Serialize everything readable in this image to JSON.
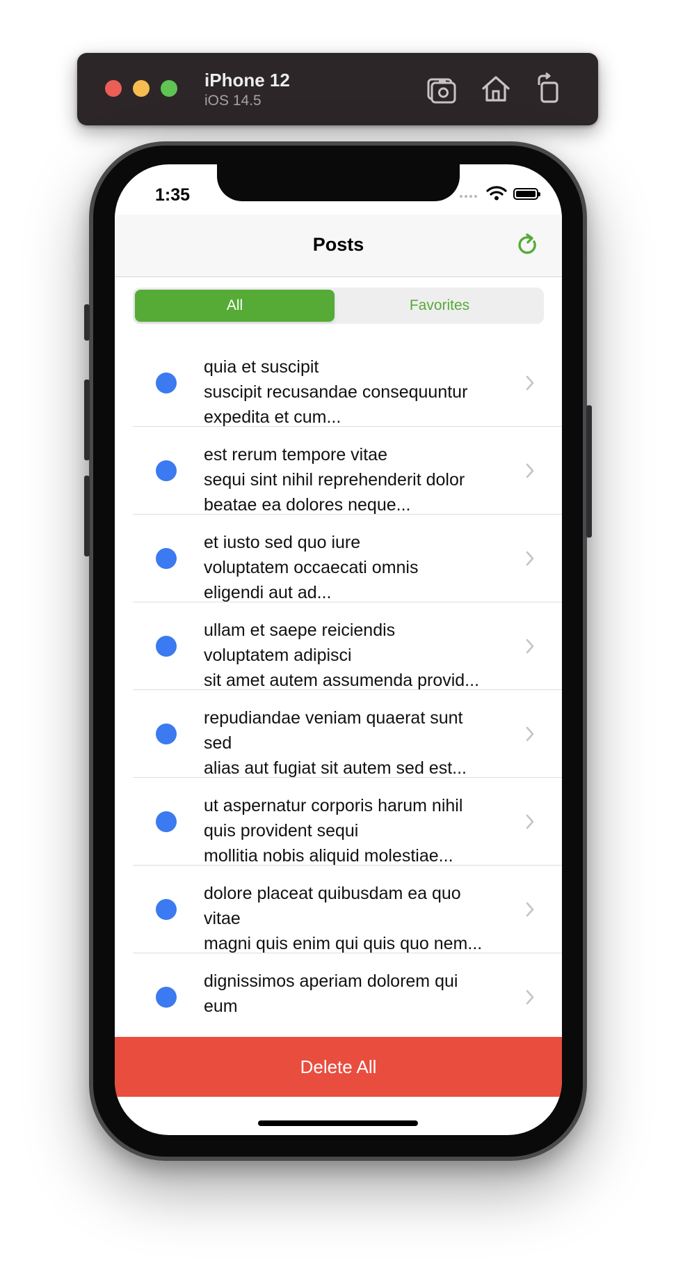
{
  "simulator": {
    "device_name": "iPhone 12",
    "os_version": "iOS 14.5",
    "icons": [
      "screenshot-icon",
      "home-icon",
      "rotate-icon"
    ]
  },
  "status_bar": {
    "time": "1:35",
    "icons": [
      "wifi-icon",
      "battery-icon"
    ]
  },
  "navbar": {
    "title": "Posts",
    "refresh_icon": "refresh-icon",
    "accent_color": "#56ab36"
  },
  "segments": {
    "all": "All",
    "favorites": "Favorites",
    "selected": "All"
  },
  "posts": [
    {
      "text": "quia et suscipit\nsuscipit recusandae consequuntur\nexpedita et cum..."
    },
    {
      "text": "est rerum tempore vitae\nsequi sint nihil reprehenderit dolor\nbeatae ea dolores neque..."
    },
    {
      "text": "et iusto sed quo iure\nvoluptatem occaecati omnis\neligendi aut ad..."
    },
    {
      "text": "ullam et saepe reiciendis\nvoluptatem adipisci\nsit amet autem assumenda provid..."
    },
    {
      "text": "repudiandae veniam quaerat sunt\nsed\nalias aut fugiat sit autem sed est..."
    },
    {
      "text": "ut aspernatur corporis harum nihil\nquis provident sequi\nmollitia nobis aliquid molestiae..."
    },
    {
      "text": "dolore placeat quibusdam ea quo\nvitae\nmagni quis enim qui quis quo nem..."
    },
    {
      "text": "dignissimos aperiam dolorem qui\neum"
    }
  ],
  "unread_dot_color": "#3b7af0",
  "delete_button": {
    "label": "Delete All",
    "color": "#e94d3e"
  }
}
